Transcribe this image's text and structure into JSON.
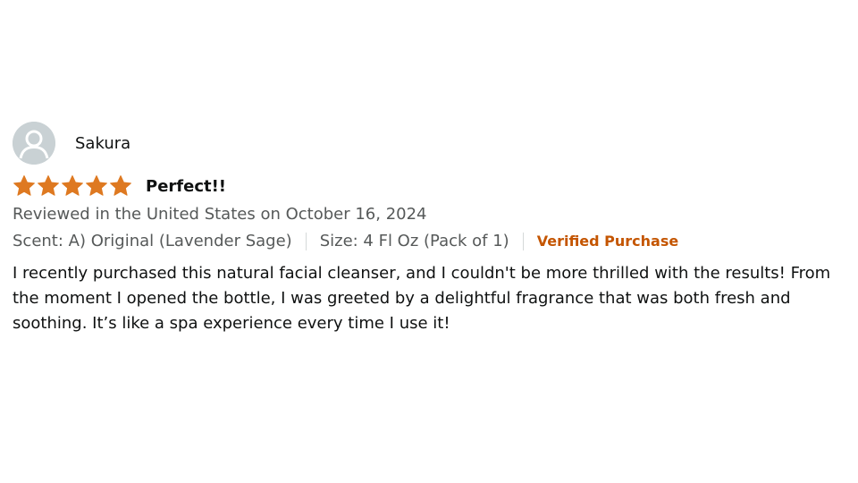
{
  "profile": {
    "name": "Sakura",
    "avatar_icon": "user-silhouette-icon"
  },
  "rating": {
    "stars": 5,
    "max_stars": 5,
    "star_color": "#de7921",
    "star_icon": "star-icon"
  },
  "review": {
    "title": "Perfect!!",
    "date_line": "Reviewed in the United States on October 16, 2024",
    "scent": "Scent: A) Original (Lavender Sage)",
    "size": "Size: 4 Fl Oz (Pack of 1)",
    "verified_label": "Verified Purchase",
    "verified_color": "#c45500",
    "body": "I recently purchased this natural facial cleanser, and I couldn't be more thrilled with the results! From the moment I opened the bottle, I was greeted by a delightful fragrance that was both fresh and soothing. It’s like a spa experience every time I use it!"
  }
}
